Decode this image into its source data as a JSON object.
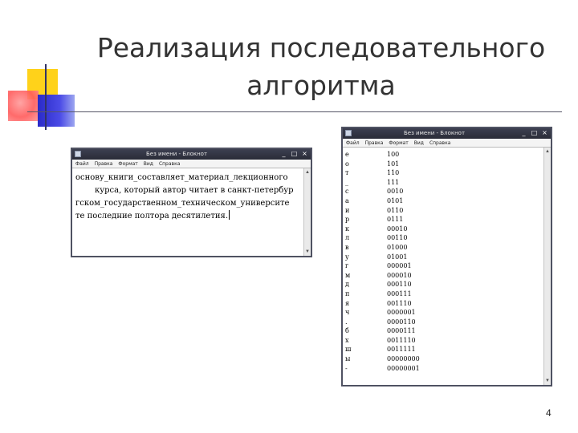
{
  "slide": {
    "title_line1": "Реализация последовательного",
    "title_line2": "алгоритма",
    "page_number": "4"
  },
  "left_window": {
    "title": "Без имени - Блокнот",
    "menu": [
      "Файл",
      "Правка",
      "Формат",
      "Вид",
      "Справка"
    ],
    "controls": [
      "_",
      "□",
      "×"
    ],
    "text_lines": [
      "основу_книги_составляет_материал_лекционного",
      "курса, который автор читает в санкт-петербур",
      "гском_государственном_техническом_университе",
      "те последние полтора десятилетия."
    ]
  },
  "right_window": {
    "title": "Без имени - Блокнот",
    "menu": [
      "Файл",
      "Правка",
      "Формат",
      "Вид",
      "Справка"
    ],
    "controls": [
      "_",
      "□",
      "×"
    ],
    "rows": [
      {
        "letter": "е",
        "code": "100"
      },
      {
        "letter": "о",
        "code": "101"
      },
      {
        "letter": "т",
        "code": "110"
      },
      {
        "letter": "_",
        "code": "111"
      },
      {
        "letter": "с",
        "code": "0010"
      },
      {
        "letter": "а",
        "code": "0101"
      },
      {
        "letter": "и",
        "code": "0110"
      },
      {
        "letter": "р",
        "code": "0111"
      },
      {
        "letter": "к",
        "code": "00010"
      },
      {
        "letter": "л",
        "code": "00110"
      },
      {
        "letter": "в",
        "code": "01000"
      },
      {
        "letter": "у",
        "code": "01001"
      },
      {
        "letter": "г",
        "code": "000001"
      },
      {
        "letter": "м",
        "code": "000010"
      },
      {
        "letter": "д",
        "code": "000110"
      },
      {
        "letter": "п",
        "code": "000111"
      },
      {
        "letter": "я",
        "code": "001110"
      },
      {
        "letter": "ч",
        "code": "0000001"
      },
      {
        "letter": ".",
        "code": "0000110"
      },
      {
        "letter": "б",
        "code": "0000111"
      },
      {
        "letter": "х",
        "code": "0011110"
      },
      {
        "letter": "ш",
        "code": "0011111"
      },
      {
        "letter": "ы",
        "code": "00000000"
      },
      {
        "letter": "-",
        "code": "00000001"
      }
    ]
  },
  "colors": {
    "titlebar": "#2f3140",
    "accent_yellow": "#ffd21a",
    "accent_red": "#ff5a5a",
    "accent_blue": "#3a3ad8"
  }
}
